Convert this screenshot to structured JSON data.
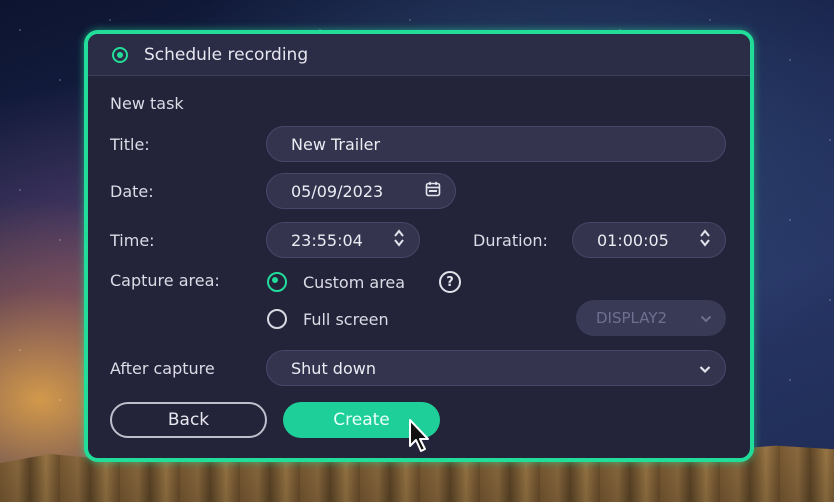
{
  "dialog": {
    "header_title": "Schedule recording",
    "section_title": "New task",
    "title_label": "Title:",
    "title_value": "New Trailer",
    "date_label": "Date:",
    "date_value": "05/09/2023",
    "time_label": "Time:",
    "time_value": "23:55:04",
    "duration_label": "Duration:",
    "duration_value": "01:00:05",
    "capture_label": "Capture area:",
    "capture_options": [
      {
        "label": "Custom area",
        "selected": true
      },
      {
        "label": "Full screen",
        "selected": false
      }
    ],
    "display_select": "DISPLAY2",
    "after_label": "After capture",
    "after_value": "Shut down",
    "back_label": "Back",
    "create_label": "Create"
  },
  "icons": {
    "header_radio": "radio-checked-icon",
    "date": "calendar-icon",
    "time_stepper": "up-down-chevron-icon",
    "duration_stepper": "up-down-chevron-icon",
    "help": "question-circle-icon",
    "dropdown": "chevron-down-icon",
    "cursor": "mouse-pointer-icon"
  },
  "colors": {
    "accent": "#22dd9a",
    "panel": "#23233a",
    "field": "#34344f"
  }
}
